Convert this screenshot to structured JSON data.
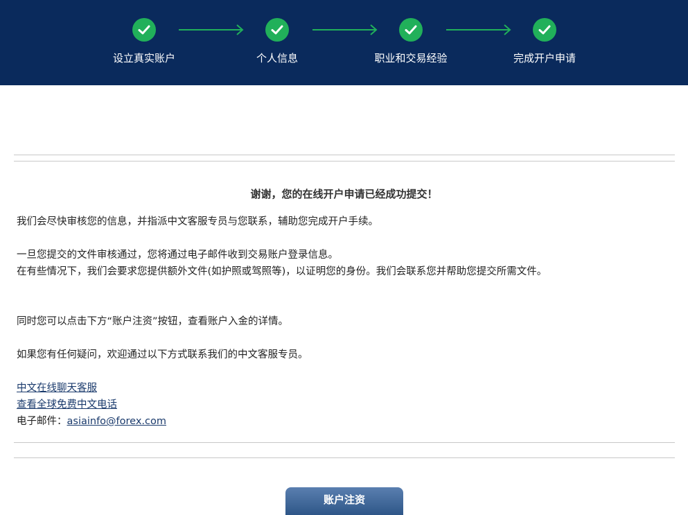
{
  "steps": [
    {
      "label": "设立真实账户",
      "icon": "check-icon"
    },
    {
      "label": "个人信息",
      "icon": "check-icon"
    },
    {
      "label": "职业和交易经验",
      "icon": "check-icon"
    },
    {
      "label": "完成开户申请",
      "icon": "check-icon"
    }
  ],
  "colors": {
    "header_bg": "#0a2a5c",
    "step_done": "#21b05a",
    "link": "#1a3a6c"
  },
  "message": {
    "title": "谢谢，您的在线开户申请已经成功提交！",
    "p1": "我们会尽快审核您的信息，并指派中文客服专员与您联系，辅助您完成开户手续。",
    "p2a": "一旦您提交的文件审核通过，您将通过电子邮件收到交易账户登录信息。",
    "p2b": "在有些情况下，我们会要求您提供额外文件(如护照或驾照等)，以证明您的身份。我们会联系您并帮助您提交所需文件。",
    "p3": "同时您可以点击下方“账户注资”按钮，查看账户入金的详情。",
    "p4": "如果您有任何疑问，欢迎通过以下方式联系我们的中文客服专员。"
  },
  "contact": {
    "chat_link": "中文在线聊天客服",
    "phone_link": "查看全球免费中文电话",
    "email_label": "电子邮件：",
    "email": "asiainfo@forex.com"
  },
  "button": {
    "fund_label": "账户注资"
  }
}
